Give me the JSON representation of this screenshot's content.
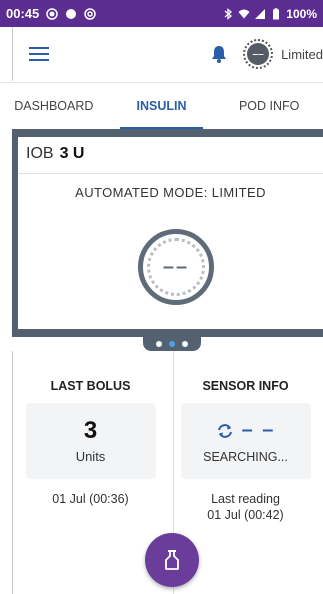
{
  "status_bar": {
    "time": "00:45",
    "battery": "100%"
  },
  "app_bar": {
    "mode_label": "Limited",
    "mode_icon_text": "––"
  },
  "tabs": [
    {
      "label": "DASHBOARD",
      "active": false
    },
    {
      "label": "INSULIN",
      "active": true
    },
    {
      "label": "POD INFO",
      "active": false
    }
  ],
  "card": {
    "iob_label": "IOB",
    "iob_value": "3 U",
    "mode_title": "AUTOMATED MODE: LIMITED",
    "circle_text": "––"
  },
  "pager": {
    "count": 3,
    "active_index": 1
  },
  "last_bolus": {
    "title": "LAST BOLUS",
    "value": "3",
    "unit": "Units",
    "timestamp": "01 Jul (00:36)"
  },
  "sensor_info": {
    "title": "SENSOR INFO",
    "value": "– –",
    "status": "SEARCHING...",
    "last_reading_label": "Last reading",
    "last_reading_time": "01 Jul (00:42)"
  },
  "colors": {
    "status_bar": "#5b2d91",
    "accent": "#2a5ea8",
    "card_frame": "#546170",
    "fab": "#6a3d9a"
  }
}
